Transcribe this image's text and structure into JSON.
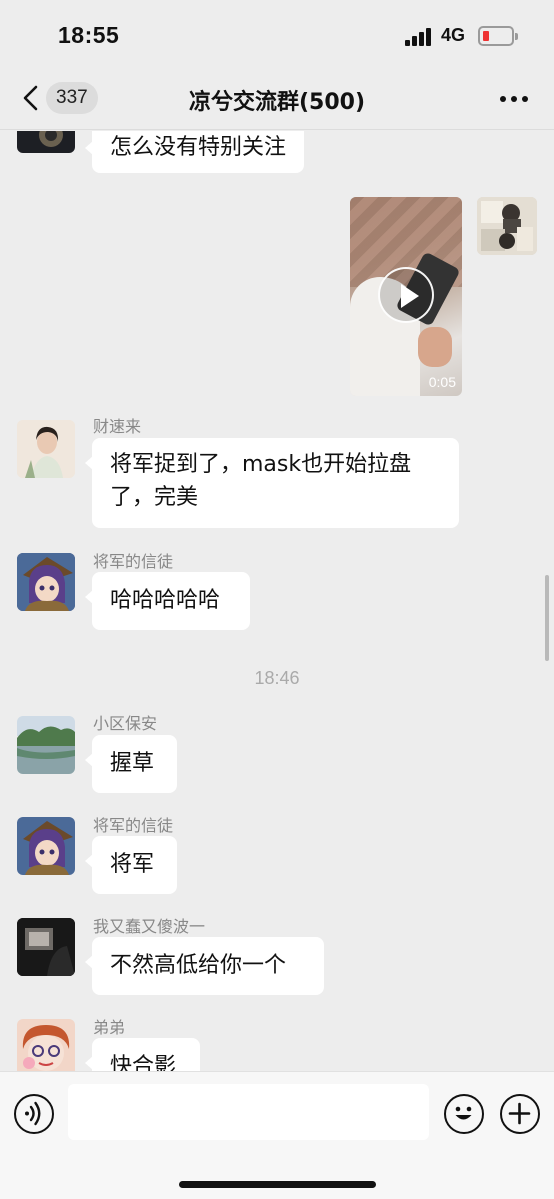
{
  "status": {
    "time": "18:55",
    "network": "4G",
    "battery_color": "#e33333"
  },
  "nav": {
    "back_icon": "chevron-left-icon",
    "unread_count": "337",
    "title": "凉兮交流群(500)",
    "more_icon": "more-dots-icon"
  },
  "messages": [
    {
      "type": "text",
      "sender": "",
      "text": "怎么没有特别关注",
      "avatar": "dark-avatar"
    },
    {
      "type": "video",
      "from_self": true,
      "duration": "0:05",
      "icon": "play-icon"
    },
    {
      "type": "text",
      "sender": "财速来",
      "text_lines": [
        "将军捉到了，mask也开始拉盘",
        "了，完美"
      ],
      "avatar": "woman-portrait-avatar"
    },
    {
      "type": "text",
      "sender": "将军的信徒",
      "text": "哈哈哈哈哈",
      "avatar": "anime-girl-avatar"
    },
    {
      "type": "time",
      "text": "18:46"
    },
    {
      "type": "text",
      "sender": "小区保安",
      "text": "握草",
      "avatar": "lake-landscape-avatar"
    },
    {
      "type": "text",
      "sender": "将军的信徒",
      "text": "将军",
      "avatar": "anime-girl-avatar"
    },
    {
      "type": "text",
      "sender": "我又蠢又傻波一",
      "text": "不然高低给你一个",
      "avatar": "dark-photo-avatar"
    },
    {
      "type": "text",
      "sender": "弟弟",
      "text": "快合影",
      "avatar": "cartoon-avatar"
    }
  ],
  "input_bar": {
    "voice_icon": "voice-icon",
    "input_value": "",
    "emoji_icon": "emoji-icon",
    "plus_icon": "plus-icon"
  }
}
